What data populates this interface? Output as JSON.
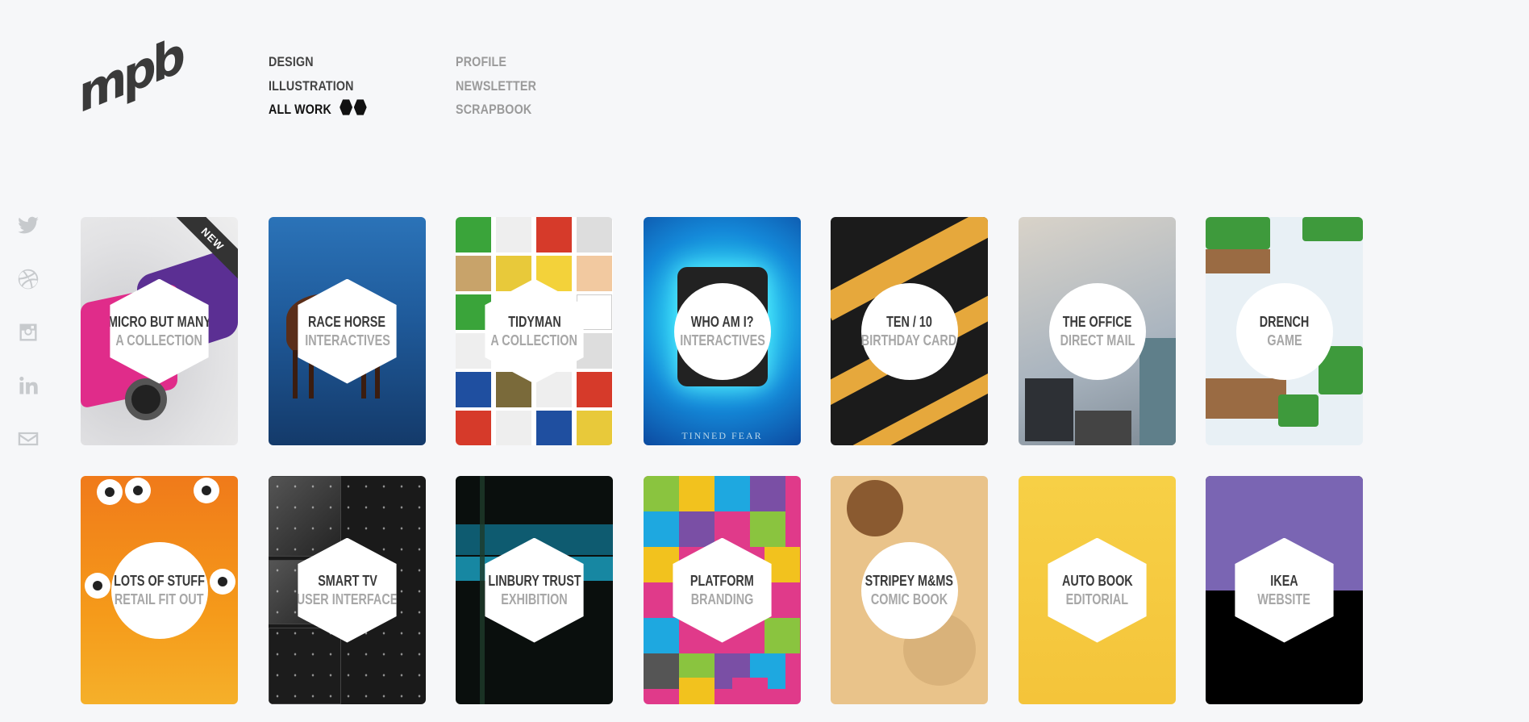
{
  "logo": {
    "text": "mpb"
  },
  "nav": {
    "primary": [
      {
        "label": "DESIGN",
        "active": false
      },
      {
        "label": "ILLUSTRATION",
        "active": false
      },
      {
        "label": "ALL WORK",
        "active": true
      }
    ],
    "secondary": [
      {
        "label": "PROFILE"
      },
      {
        "label": "NEWSLETTER"
      },
      {
        "label": "SCRAPBOOK"
      }
    ]
  },
  "social": [
    "twitter-icon",
    "dribbble-icon",
    "instagram-icon",
    "linkedin-icon",
    "mail-icon"
  ],
  "projects": [
    {
      "title": "MICRO BUT MANY",
      "subtitle": "A COLLECTION",
      "badge": "NEW",
      "shape": "hex"
    },
    {
      "title": "RACE HORSE",
      "subtitle": "INTERACTIVES",
      "shape": "hex"
    },
    {
      "title": "TIDYMAN",
      "subtitle": "A COLLECTION",
      "shape": "hex"
    },
    {
      "title": "WHO AM I?",
      "subtitle": "INTERACTIVES",
      "caption": "TINNED FEAR",
      "shape": "circle"
    },
    {
      "title": "TEN / 10",
      "subtitle": "BIRTHDAY CARD",
      "shape": "circle"
    },
    {
      "title": "THE OFFICE",
      "subtitle": "DIRECT MAIL",
      "shape": "circle"
    },
    {
      "title": "DRENCH",
      "subtitle": "GAME",
      "shape": "circle"
    },
    {
      "title": "LOTS OF STUFF",
      "subtitle": "RETAIL FIT OUT",
      "shape": "circle"
    },
    {
      "title": "SMART TV",
      "subtitle": "USER INTERFACE",
      "shape": "hex"
    },
    {
      "title": "LINBURY TRUST",
      "subtitle": "EXHIBITION",
      "shape": "hex"
    },
    {
      "title": "PLATFORM",
      "subtitle": "BRANDING",
      "shape": "hex"
    },
    {
      "title": "STRIPEY M&MS",
      "subtitle": "COMIC BOOK",
      "shape": "circle"
    },
    {
      "title": "AUTO BOOK",
      "subtitle": "EDITORIAL",
      "shape": "hex"
    },
    {
      "title": "IKEA",
      "subtitle": "WEBSITE",
      "shape": "hex"
    }
  ]
}
